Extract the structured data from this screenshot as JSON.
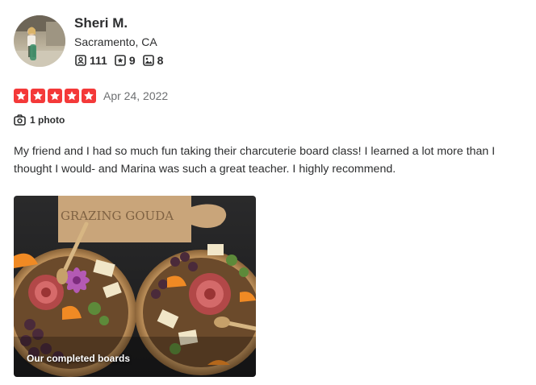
{
  "user": {
    "name": "Sheri M.",
    "location": "Sacramento, CA",
    "friends_count": "111",
    "reviews_count": "9",
    "photos_count": "8"
  },
  "review": {
    "rating": 5,
    "rating_max": 5,
    "date": "Apr 24, 2022",
    "photo_count_label": "1 photo",
    "text": "My friend and I had so much fun taking their charcuterie board class! I learned a lot more than I thought I would- and Marina was such a great teacher. I highly recommend.",
    "photo_caption": "Our completed boards"
  },
  "photo_board_text": "GRAZING GOUDA",
  "colors": {
    "star_red": "#f43939",
    "text_primary": "#2d2e2f",
    "text_secondary": "#6e7072"
  },
  "icons": {
    "friends": "friends-icon",
    "reviews": "review-star-icon",
    "photos": "photo-icon",
    "camera": "camera-icon",
    "star": "star-icon"
  }
}
